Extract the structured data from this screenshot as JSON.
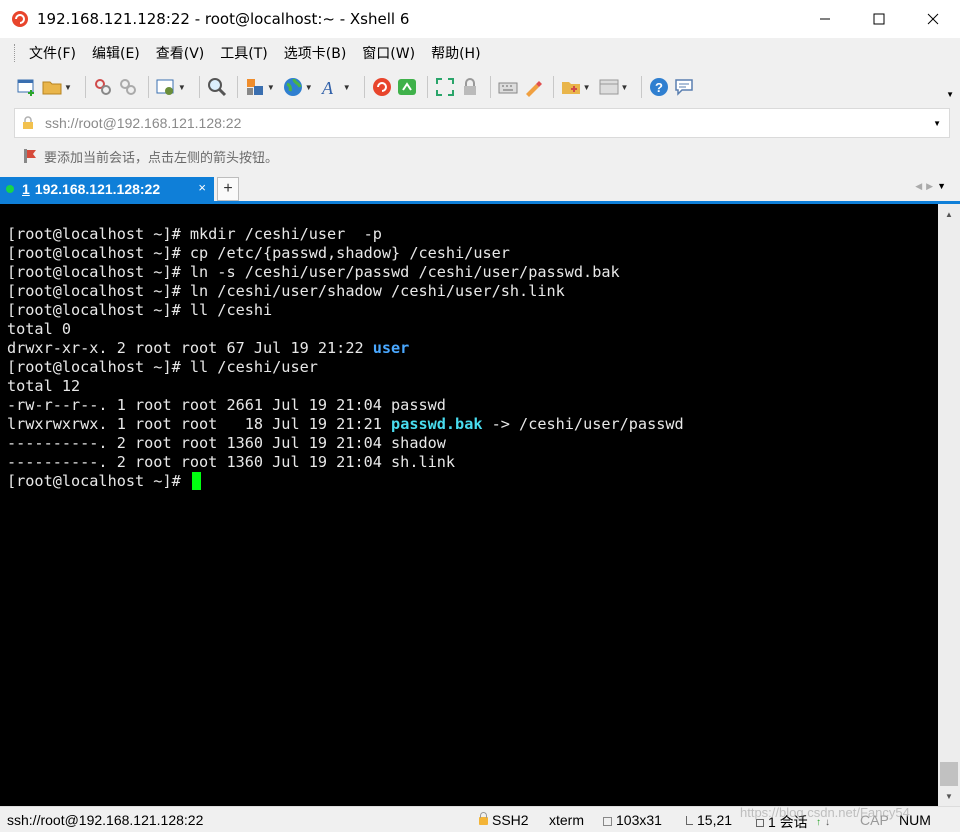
{
  "window": {
    "title": "192.168.121.128:22 - root@localhost:~ - Xshell 6",
    "controls": {
      "minimize": "─",
      "maximize": "☐",
      "close": "✕"
    }
  },
  "menu": [
    "文件(F)",
    "编辑(E)",
    "查看(V)",
    "工具(T)",
    "选项卡(B)",
    "窗口(W)",
    "帮助(H)"
  ],
  "toolbar": {
    "icons": [
      "new-session-icon",
      "open-folder-icon",
      "reconnect-icon",
      "disconnect-icon",
      "properties-icon",
      "find-icon",
      "copy-paste-icon",
      "globe-icon",
      "font-icon",
      "xshell-icon",
      "xftp-icon",
      "fullscreen-icon",
      "lock-icon",
      "keyboard-icon",
      "highlight-icon",
      "new-folder-icon",
      "layout-icon",
      "help-icon",
      "chat-icon"
    ]
  },
  "address": {
    "value": "ssh://root@192.168.121.128:22",
    "dropdown": "▼"
  },
  "hint": {
    "text": "要添加当前会话，点击左侧的箭头按钮。"
  },
  "tabs": {
    "active": {
      "number": "1",
      "label": "192.168.121.128:22",
      "close": "×"
    },
    "add": "+"
  },
  "terminal": {
    "lines": [
      [
        {
          "t": "[root@localhost ~]# mkdir /ceshi/user  -p"
        }
      ],
      [
        {
          "t": "[root@localhost ~]# cp /etc/{passwd,shadow} /ceshi/user"
        }
      ],
      [
        {
          "t": "[root@localhost ~]# ln -s /ceshi/user/passwd /ceshi/user/passwd.bak"
        }
      ],
      [
        {
          "t": "[root@localhost ~]# ln /ceshi/user/shadow /ceshi/user/sh.link"
        }
      ],
      [
        {
          "t": "[root@localhost ~]# ll /ceshi"
        }
      ],
      [
        {
          "t": "total 0"
        }
      ],
      [
        {
          "t": "drwxr-xr-x. 2 root root 67 Jul 19 21:22 "
        },
        {
          "t": "user",
          "c": "blue"
        }
      ],
      [
        {
          "t": "[root@localhost ~]# ll /ceshi/user"
        }
      ],
      [
        {
          "t": "total 12"
        }
      ],
      [
        {
          "t": "-rw-r--r--. 1 root root 2661 Jul 19 21:04 passwd"
        }
      ],
      [
        {
          "t": "lrwxrwxrwx. 1 root root   18 Jul 19 21:21 "
        },
        {
          "t": "passwd.bak",
          "c": "cyan"
        },
        {
          "t": " -> /ceshi/user/passwd"
        }
      ],
      [
        {
          "t": "----------. 2 root root 1360 Jul 19 21:04 shadow"
        }
      ],
      [
        {
          "t": "----------. 2 root root 1360 Jul 19 21:04 sh.link"
        }
      ],
      [
        {
          "t": "[root@localhost ~]# "
        },
        {
          "cursor": true
        }
      ]
    ]
  },
  "status": {
    "address": "ssh://root@192.168.121.128:22",
    "protocol": "SSH2",
    "terminal_type": "xterm",
    "size": "103x31",
    "cursor_pos": "15,21",
    "sessions": "1 会话",
    "caps": "CAP",
    "num": "NUM",
    "watermark": "https://blog.csdn.net/Fancy54"
  }
}
